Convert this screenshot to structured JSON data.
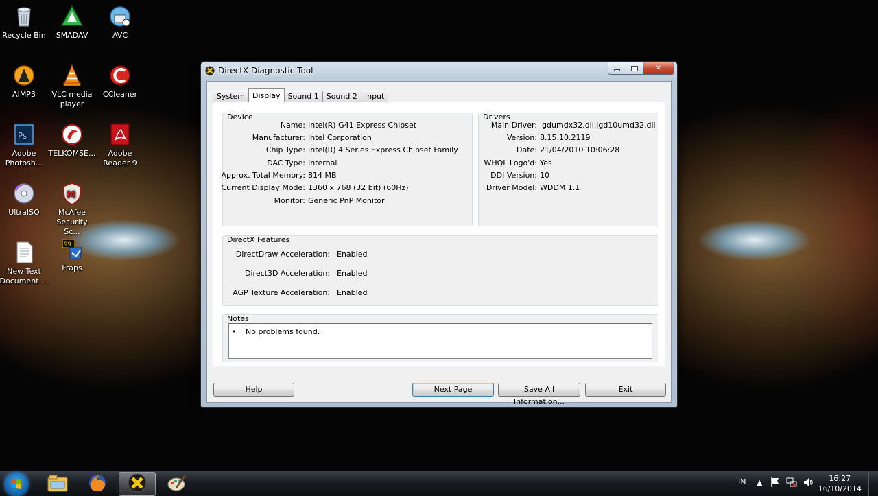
{
  "desktop": {
    "icons": [
      {
        "label": "Recycle Bin",
        "icon": "recycle-bin-icon"
      },
      {
        "label": "SMADAV",
        "icon": "smadav-icon"
      },
      {
        "label": "AVC",
        "icon": "avc-icon"
      },
      {
        "label": "AIMP3",
        "icon": "aimp-icon"
      },
      {
        "label": "VLC media player",
        "icon": "vlc-icon"
      },
      {
        "label": "CCleaner",
        "icon": "ccleaner-icon"
      },
      {
        "label": "Adobe Photosh...",
        "icon": "photoshop-icon"
      },
      {
        "label": "TELKOMSE...",
        "icon": "telkomsel-icon"
      },
      {
        "label": "Adobe Reader 9",
        "icon": "adobe-reader-icon"
      },
      {
        "label": "UltraISO",
        "icon": "ultraiso-icon"
      },
      {
        "label": "McAfee Security Sc...",
        "icon": "mcafee-icon"
      },
      {
        "label": "New Text Document ...",
        "icon": "text-document-icon"
      },
      {
        "label": "Fraps",
        "icon": "fraps-icon"
      }
    ]
  },
  "window": {
    "title": "DirectX Diagnostic Tool",
    "close_glyph": "✕",
    "tabs": [
      {
        "label": "System",
        "active": false
      },
      {
        "label": "Display",
        "active": true
      },
      {
        "label": "Sound 1",
        "active": false
      },
      {
        "label": "Sound 2",
        "active": false
      },
      {
        "label": "Input",
        "active": false
      }
    ],
    "device": {
      "heading": "Device",
      "rows": [
        {
          "key": "Name:",
          "value": "Intel(R) G41 Express Chipset"
        },
        {
          "key": "Manufacturer:",
          "value": "Intel Corporation"
        },
        {
          "key": "Chip Type:",
          "value": "Intel(R) 4 Series Express Chipset Family"
        },
        {
          "key": "DAC Type:",
          "value": "Internal"
        },
        {
          "key": "Approx. Total Memory:",
          "value": "814 MB"
        },
        {
          "key": "Current Display Mode:",
          "value": "1360 x 768 (32 bit) (60Hz)"
        },
        {
          "key": "Monitor:",
          "value": "Generic PnP Monitor"
        }
      ]
    },
    "drivers": {
      "heading": "Drivers",
      "rows": [
        {
          "key": "Main Driver:",
          "value": "igdumdx32.dll,igd10umd32.dll"
        },
        {
          "key": "Version:",
          "value": "8.15.10.2119"
        },
        {
          "key": "Date:",
          "value": "21/04/2010 10:06:28"
        },
        {
          "key": "WHQL Logo'd:",
          "value": "Yes"
        },
        {
          "key": "DDI Version:",
          "value": "10"
        },
        {
          "key": "Driver Model:",
          "value": "WDDM 1.1"
        }
      ]
    },
    "features": {
      "heading": "DirectX Features",
      "rows": [
        {
          "key": "DirectDraw Acceleration:",
          "value": "Enabled"
        },
        {
          "key": "Direct3D Acceleration:",
          "value": "Enabled"
        },
        {
          "key": "AGP Texture Acceleration:",
          "value": "Enabled"
        }
      ]
    },
    "notes": {
      "heading": "Notes",
      "bullet": "•",
      "items": [
        "No problems found."
      ]
    },
    "buttons": {
      "help": "Help",
      "next_page": "Next Page",
      "save_all": "Save All Information...",
      "exit": "Exit"
    }
  },
  "taskbar": {
    "pinned": [
      {
        "icon": "explorer-icon"
      },
      {
        "icon": "firefox-icon"
      },
      {
        "icon": "directx-icon",
        "active": true
      },
      {
        "icon": "paint-icon"
      }
    ],
    "tray": {
      "language": "IN",
      "time": "16:27",
      "date": "16/10/2014"
    }
  },
  "colors": {
    "accent": "#3c7fb1",
    "close_red": "#c74c35"
  }
}
